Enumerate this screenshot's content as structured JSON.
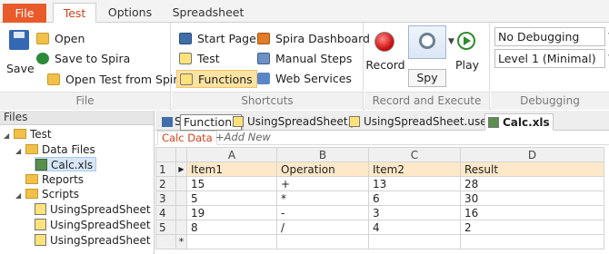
{
  "ribbon_tabs": [
    "File",
    "Test",
    "Options",
    "Spreadsheet"
  ],
  "groups": {
    "file": {
      "label": "File",
      "save": "Save",
      "open": "Open",
      "save_to_spira": "Save to Spira",
      "open_from_spira": "Open Test from Spira"
    },
    "shortcuts": {
      "label": "Shortcuts",
      "start_page": "Start Page",
      "test": "Test",
      "functions": "Functions",
      "spira_dashboard": "Spira Dashboard",
      "manual_steps": "Manual Steps",
      "web_services": "Web Services"
    },
    "record": {
      "label": "Record and Execute",
      "record": "Record",
      "spy": "Spy",
      "play": "Play"
    },
    "debugging": {
      "label": "Debugging",
      "mode": "No Debugging",
      "level": "Level 1 (Minimal)"
    }
  },
  "files_panel": {
    "title": "Files",
    "tree": {
      "root": "Test",
      "data_files": "Data Files",
      "calc": "Calc.xls",
      "reports": "Reports",
      "scripts": "Scripts",
      "script_items": [
        "UsingSpreadSheet",
        "UsingSpreadSheet",
        "UsingSpreadSheet"
      ]
    }
  },
  "doc_tabs": {
    "tab1_partial": "S",
    "tooltip": "Functions",
    "tab2": "UsingSpreadSheet.js",
    "tab3": "UsingSpreadSheet.user.js",
    "tab4": "Calc.xls"
  },
  "sheet_tabs": {
    "active": "Calc Data",
    "add": "+Add New"
  },
  "grid": {
    "columns": [
      "A",
      "B",
      "C",
      "D"
    ],
    "rows": [
      {
        "n": "1",
        "cells": [
          "Item1",
          "Operation",
          "Item2",
          "Result"
        ]
      },
      {
        "n": "2",
        "cells": [
          "15",
          "+",
          "13",
          "28"
        ]
      },
      {
        "n": "3",
        "cells": [
          "5",
          "*",
          "6",
          "30"
        ]
      },
      {
        "n": "4",
        "cells": [
          "19",
          "-",
          "3",
          "16"
        ]
      },
      {
        "n": "5",
        "cells": [
          "8",
          "/",
          "4",
          "2"
        ]
      }
    ],
    "new_row_marker": "*"
  },
  "colors": {
    "file_tab": "#e95a2b",
    "accent": "#d0431d",
    "highlight": "#fde3a2",
    "selected_row": "#fde9c9"
  }
}
